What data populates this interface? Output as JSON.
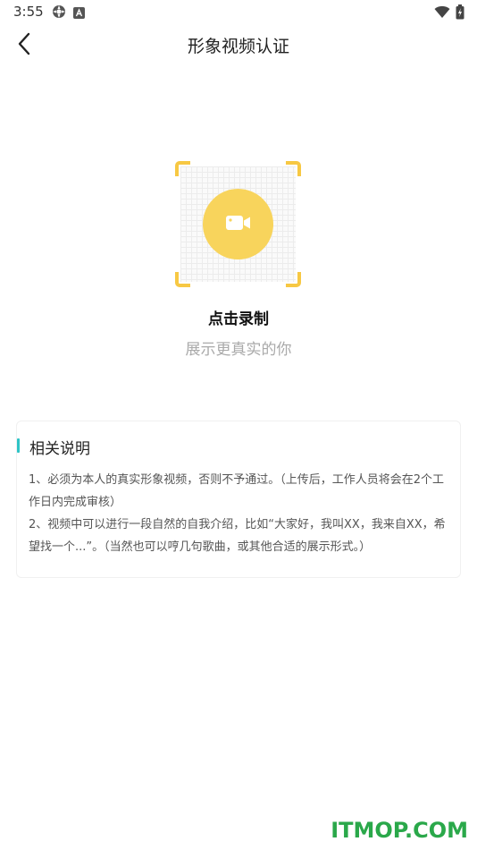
{
  "status_bar": {
    "time": "3:55",
    "icons_left": [
      "settings-gear-icon",
      "a-notification-icon"
    ],
    "icons_right": [
      "wifi-icon",
      "battery-icon"
    ]
  },
  "nav": {
    "title": "形象视频认证",
    "back_icon": "chevron-left-icon"
  },
  "record": {
    "label": "点击录制",
    "subtitle": "展示更真实的你",
    "icon": "video-camera-icon",
    "accent_color": "#f8d45c"
  },
  "info": {
    "title": "相关说明",
    "accent_color": "#2ec4c6",
    "items": [
      "1、必须为本人的真实形象视频，否则不予通过。（上传后，工作人员将会在2个工作日内完成审核）",
      "2、视频中可以进行一段自然的自我介绍，比如“大家好，我叫XX，我来自XX，希望找一个...”。（当然也可以哼几句歌曲，或其他合适的展示形式。）"
    ]
  },
  "watermark": "ITMOP.COM"
}
